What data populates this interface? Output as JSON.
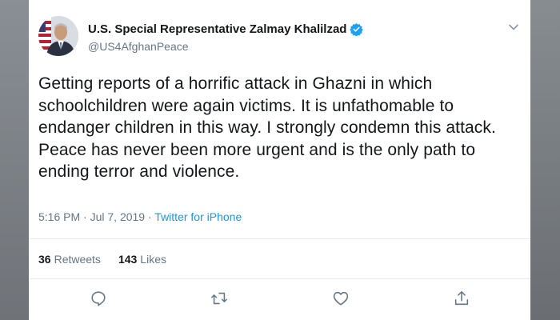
{
  "tweet": {
    "author_name": "U.S. Special Representative Zalmay Khalilzad",
    "handle": "@US4AfghanPeace",
    "text": "Getting reports of a horrific attack in Ghazni in which schoolchildren were again victims. It is unfathomable to endanger children in this way. I strongly condemn this attack. Peace has never been more urgent and is the only path to ending terror and violence.",
    "time": "5:16 PM",
    "date": "Jul 7, 2019",
    "separator": " · ",
    "source": "Twitter for iPhone",
    "retweets_count": "36",
    "retweets_label": "Retweets",
    "likes_count": "143",
    "likes_label": "Likes"
  },
  "icons": {
    "verified": "verified-badge-icon",
    "menu": "chevron-down-icon",
    "reply": "reply-icon",
    "retweet": "retweet-icon",
    "like": "heart-icon",
    "share": "share-icon"
  },
  "colors": {
    "text": "#14171a",
    "secondary": "#657786",
    "link": "#1b95e0",
    "verified": "#1da1f2",
    "background": "#7d8186"
  }
}
